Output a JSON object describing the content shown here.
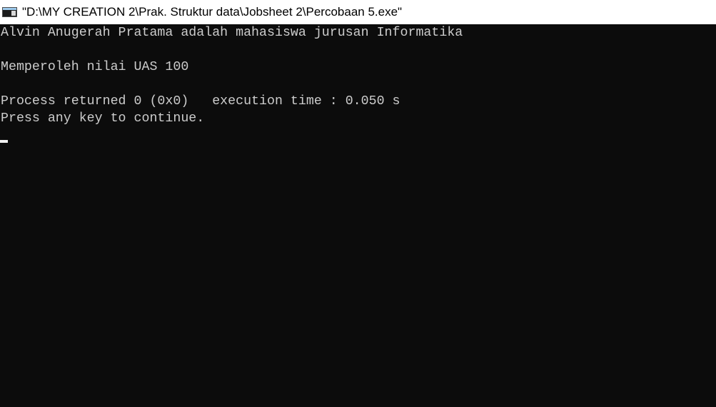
{
  "window": {
    "title": "\"D:\\MY CREATION 2\\Prak. Struktur data\\Jobsheet 2\\Percobaan 5.exe\"",
    "icon": "console-window-icon"
  },
  "console": {
    "lines": [
      "Alvin Anugerah Pratama adalah mahasiswa jurusan Informatika",
      "Memperoleh nilai UAS 100",
      "Process returned 0 (0x0)   execution time : 0.050 s",
      "Press any key to continue."
    ]
  },
  "colors": {
    "console_background": "#0c0c0c",
    "console_text": "#cccccc",
    "titlebar_background": "#ffffff"
  }
}
